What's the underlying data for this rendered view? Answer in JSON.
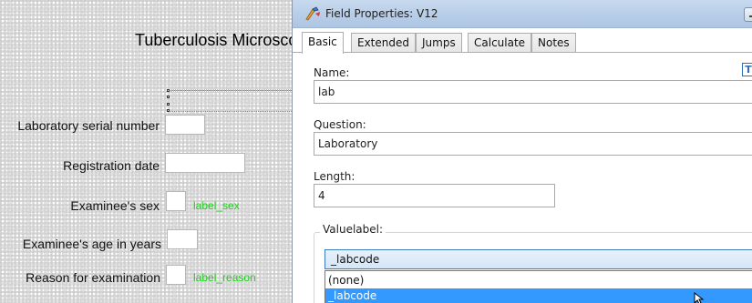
{
  "form": {
    "title": "Tuberculosis Microscopy",
    "fields": [
      {
        "label": "Laboratory serial number",
        "value_label": ""
      },
      {
        "label": "Registration date",
        "value_label": ""
      },
      {
        "label": "Examinee's sex",
        "value_label": "label_sex"
      },
      {
        "label": "Examinee's age in years",
        "value_label": ""
      },
      {
        "label": "Reason for examination",
        "value_label": "label_reason"
      }
    ]
  },
  "dialog": {
    "title": "Field Properties: V12",
    "tabs": [
      "Basic",
      "Extended",
      "Jumps",
      "Calculate",
      "Notes"
    ],
    "name_label": "Name:",
    "name_value": "lab",
    "t_button": "T",
    "question_label": "Question:",
    "question_value": "Laboratory",
    "length_label": "Length:",
    "length_value": "4",
    "valuelabel_group": "Valuelabel:",
    "valuelabel_selected": "_labcode",
    "options": [
      "(none)",
      "_labcode"
    ]
  },
  "colors": {
    "accent": "#3399ff",
    "value_label": "#1ad01a",
    "titlebar": "#b6cce7"
  }
}
